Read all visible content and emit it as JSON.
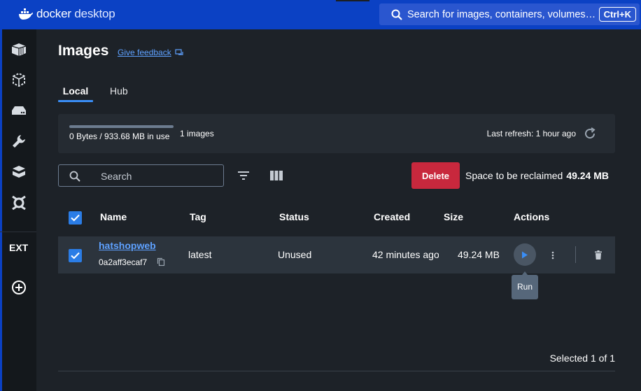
{
  "app": {
    "brand_bold": "docker",
    "brand_light": " desktop"
  },
  "topbar": {
    "search_placeholder": "Search for images, containers, volumes…",
    "shortcut": "Ctrl+K"
  },
  "sidebar": {
    "items": [
      {
        "name": "containers",
        "icon": "containers-icon"
      },
      {
        "name": "images",
        "icon": "images-icon"
      },
      {
        "name": "volumes",
        "icon": "volumes-icon"
      },
      {
        "name": "dev-environments",
        "icon": "wrench-icon"
      },
      {
        "name": "learning-center",
        "icon": "cube-stack-icon"
      },
      {
        "name": "scout",
        "icon": "scout-icon"
      }
    ],
    "ext_label": "EXT",
    "add_extension_icon": "plus-circle-icon"
  },
  "page": {
    "title": "Images",
    "feedback_label": "Give feedback"
  },
  "tabs": [
    {
      "label": "Local",
      "active": true
    },
    {
      "label": "Hub",
      "active": false
    }
  ],
  "usage": {
    "text": "0 Bytes / 933.68 MB in use",
    "used_fraction": 0.0,
    "image_count": "1 images",
    "last_refresh": "Last refresh: 1 hour ago"
  },
  "toolbar": {
    "search_placeholder": "Search",
    "delete_label": "Delete",
    "reclaim_label": "Space to be reclaimed",
    "reclaim_value": "49.24 MB"
  },
  "table": {
    "headers": {
      "name": "Name",
      "tag": "Tag",
      "status": "Status",
      "created": "Created",
      "size": "Size",
      "actions": "Actions"
    },
    "rows": [
      {
        "selected": true,
        "name": "hatshopweb",
        "id": "0a2aff3ecaf7",
        "tag": "latest",
        "status": "Unused",
        "created": "42 minutes ago",
        "size": "49.24 MB"
      }
    ],
    "tooltip": "Run",
    "selected_count": "Selected 1 of 1"
  },
  "colors": {
    "accent": "#0b41c4",
    "link": "#5ea1ff",
    "danger": "#c8283d",
    "checkbox": "#2b7de6",
    "background": "#1d2228"
  }
}
